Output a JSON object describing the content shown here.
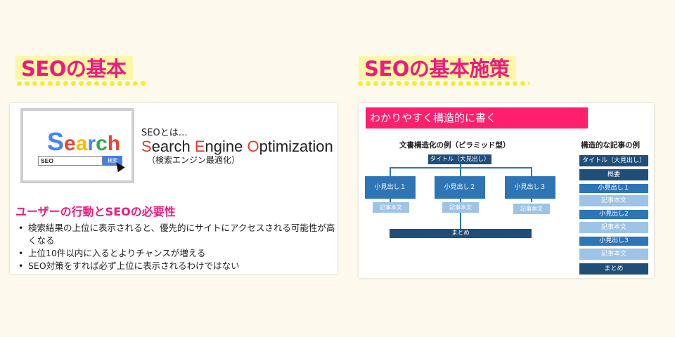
{
  "left_section": {
    "heading": "SEOの基本",
    "search_logo": [
      "S",
      "e",
      "a",
      "r",
      "c",
      "h"
    ],
    "search_input": "SEO",
    "search_button": "検索",
    "seo_towa": "SEOとは…",
    "seo_full": {
      "s": "S",
      "earch": "earch ",
      "e": "E",
      "ngine": "ngine ",
      "o": "O",
      "ptimization": "ptimization"
    },
    "seo_jp": "（検索エンジン最適化）",
    "sub_heading": "ユーザーの行動とSEOの必要性",
    "bullets": [
      "検索結果の上位に表示されると、優先的にサイトにアクセスされる可能性が高くなる",
      "上位10件以内に入るとよりチャンスが増える",
      "SEO対策をすれば必ず上位に表示されるわけではない"
    ]
  },
  "right_section": {
    "heading": "SEOの基本施策",
    "banner": "わかりやすく構造的に書く",
    "pyramid": {
      "title": "文書構造化の例（ピラミッド型）",
      "top": "タイトル（大見出し）",
      "subs": [
        "小見出し１",
        "小見出し２",
        "小見出し３"
      ],
      "bodies": [
        "記事本文",
        "記事本文",
        "記事本文"
      ],
      "summary": "まとめ"
    },
    "article": {
      "title": "構造的な記事の例",
      "items": [
        {
          "label": "タイトル（大見出し）",
          "tone": "dark"
        },
        {
          "label": "概要",
          "tone": "dark"
        },
        {
          "label": "小見出し１",
          "tone": "mid"
        },
        {
          "label": "記事本文",
          "tone": "light"
        },
        {
          "label": "小見出し2",
          "tone": "mid"
        },
        {
          "label": "記事本文",
          "tone": "light"
        },
        {
          "label": "小見出し3",
          "tone": "mid"
        },
        {
          "label": "記事本文",
          "tone": "light"
        },
        {
          "label": "まとめ",
          "tone": "dark"
        }
      ]
    }
  },
  "colors": {
    "accent_pink": "#f0197d",
    "banner_pink": "#ff1f6d",
    "dark_blue": "#1f4e79",
    "mid_blue": "#2e75b6",
    "light_blue": "#9dc3e6",
    "google_blue": "#4285f4",
    "google_red": "#ea4335",
    "google_yellow": "#fbbc05",
    "google_green": "#34a853"
  }
}
